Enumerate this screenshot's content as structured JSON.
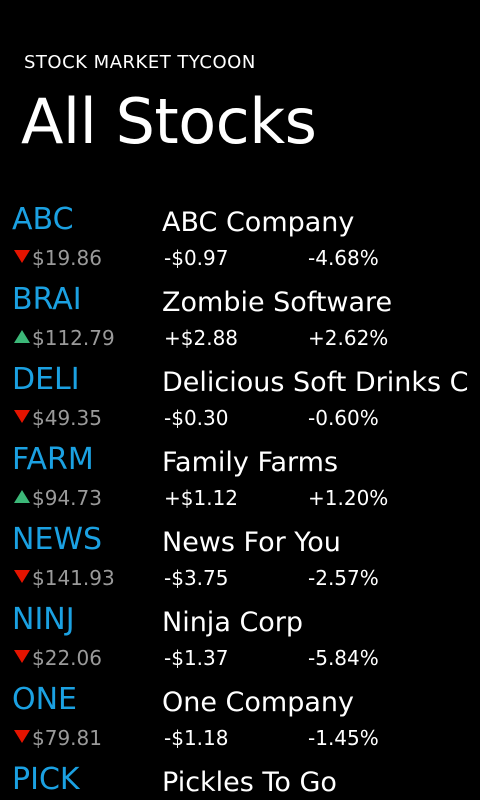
{
  "header": {
    "app_title": "STOCK MARKET TYCOON",
    "page_title": "All Stocks"
  },
  "colors": {
    "background": "#000000",
    "accent": "#1ba1e2",
    "down": "#e51400",
    "up": "#3cb878",
    "secondary_text": "#9a9a9a"
  },
  "stocks": [
    {
      "symbol": "ABC",
      "direction": "down",
      "price": "$19.86",
      "company": "ABC Company",
      "change": "-$0.97",
      "percent": "-4.68%"
    },
    {
      "symbol": "BRAI",
      "direction": "up",
      "price": "$112.79",
      "company": "Zombie Software",
      "change": "+$2.88",
      "percent": "+2.62%"
    },
    {
      "symbol": "DELI",
      "direction": "down",
      "price": "$49.35",
      "company": "Delicious Soft Drinks C",
      "change": "-$0.30",
      "percent": "-0.60%"
    },
    {
      "symbol": "FARM",
      "direction": "up",
      "price": "$94.73",
      "company": "Family Farms",
      "change": "+$1.12",
      "percent": "+1.20%"
    },
    {
      "symbol": "NEWS",
      "direction": "down",
      "price": "$141.93",
      "company": "News For You",
      "change": "-$3.75",
      "percent": "-2.57%"
    },
    {
      "symbol": "NINJ",
      "direction": "down",
      "price": "$22.06",
      "company": "Ninja Corp",
      "change": "-$1.37",
      "percent": "-5.84%"
    },
    {
      "symbol": "ONE",
      "direction": "down",
      "price": "$79.81",
      "company": "One Company",
      "change": "-$1.18",
      "percent": "-1.45%"
    },
    {
      "symbol": "PICK",
      "direction": "",
      "price": "",
      "company": "Pickles To Go",
      "change": "",
      "percent": ""
    }
  ]
}
